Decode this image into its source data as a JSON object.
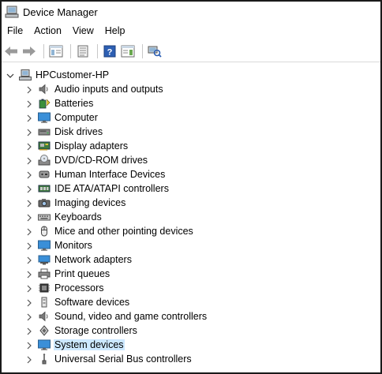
{
  "window": {
    "title": "Device Manager"
  },
  "menubar": {
    "items": [
      "File",
      "Action",
      "View",
      "Help"
    ]
  },
  "toolbar": {
    "buttons": [
      "back-icon",
      "forward-icon",
      "show-hide-console-tree-icon",
      "properties-icon",
      "help-icon",
      "action-pane-icon",
      "scan-hardware-icon"
    ]
  },
  "tree": {
    "root": {
      "label": "HPCustomer-HP",
      "expanded": true,
      "icon": "computer-icon"
    },
    "children": [
      {
        "label": "Audio inputs and outputs",
        "icon": "speaker-icon"
      },
      {
        "label": "Batteries",
        "icon": "battery-icon"
      },
      {
        "label": "Computer",
        "icon": "monitor-icon"
      },
      {
        "label": "Disk drives",
        "icon": "disk-drive-icon"
      },
      {
        "label": "Display adapters",
        "icon": "display-adapter-icon"
      },
      {
        "label": "DVD/CD-ROM drives",
        "icon": "dvd-icon"
      },
      {
        "label": "Human Interface Devices",
        "icon": "hid-icon"
      },
      {
        "label": "IDE ATA/ATAPI controllers",
        "icon": "ide-controller-icon"
      },
      {
        "label": "Imaging devices",
        "icon": "camera-icon"
      },
      {
        "label": "Keyboards",
        "icon": "keyboard-icon"
      },
      {
        "label": "Mice and other pointing devices",
        "icon": "mouse-icon"
      },
      {
        "label": "Monitors",
        "icon": "monitor-icon"
      },
      {
        "label": "Network adapters",
        "icon": "network-adapter-icon"
      },
      {
        "label": "Print queues",
        "icon": "printer-icon"
      },
      {
        "label": "Processors",
        "icon": "processor-icon"
      },
      {
        "label": "Software devices",
        "icon": "software-device-icon"
      },
      {
        "label": "Sound, video and game controllers",
        "icon": "speaker-icon"
      },
      {
        "label": "Storage controllers",
        "icon": "storage-controller-icon"
      },
      {
        "label": "System devices",
        "icon": "monitor-icon",
        "selected": true
      },
      {
        "label": "Universal Serial Bus controllers",
        "icon": "usb-icon"
      }
    ]
  },
  "colors": {
    "selection": "#cce8ff",
    "icon_blue": "#3a8fd8"
  }
}
